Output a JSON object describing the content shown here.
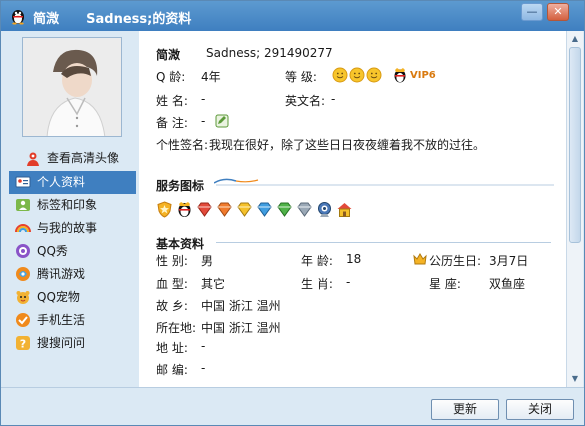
{
  "window": {
    "title": "简溦      Sadness;的资料",
    "minimize_label": "—",
    "close_label": "✕"
  },
  "left_panel": {
    "hd_avatar_link": "查看高清头像",
    "nav": [
      {
        "label": "个人资料",
        "icon": "id-card-icon",
        "active": true
      },
      {
        "label": "标签和印象",
        "icon": "tag-icon",
        "active": false
      },
      {
        "label": "与我的故事",
        "icon": "rainbow-icon",
        "active": false
      },
      {
        "label": "QQ秀",
        "icon": "qq-show-icon",
        "active": false
      },
      {
        "label": "腾讯游戏",
        "icon": "game-icon",
        "active": false
      },
      {
        "label": "QQ宠物",
        "icon": "pet-icon",
        "active": false
      },
      {
        "label": "手机生活",
        "icon": "check-mark-icon",
        "active": false
      },
      {
        "label": "搜搜问问",
        "icon": "question-icon",
        "active": false
      }
    ]
  },
  "profile": {
    "nickname": "简溦",
    "handle_and_number": "Sadness;   291490277",
    "qage_label": "Q    龄:",
    "qage_value": "4年",
    "level_label": "等    级:",
    "vip_label": "VIP6",
    "name_label": "姓    名:",
    "name_value": "-",
    "english_name_label": "英文名:",
    "english_name_value": "-",
    "remark_label": "备    注:",
    "remark_value": "-",
    "signature_label": "个性签名:",
    "signature_value": "我现在很好，除了这些日日夜夜缠着我不放的过往。"
  },
  "service_icons": {
    "title": "服务图标",
    "icons": [
      "shield-badge-icon",
      "qq-penguin-badge-icon",
      "diamond-red-icon",
      "diamond-red2-icon",
      "diamond-yellow-icon",
      "diamond-blue-icon",
      "diamond-green-icon",
      "diamond-grey-icon",
      "webcam-badge-icon",
      "house-badge-icon"
    ]
  },
  "basic_info": {
    "title": "基本资料",
    "gender_label": "性    别:",
    "gender_value": "男",
    "age_label": "年    龄:",
    "age_value": "18",
    "birthday_label": "公历生日:",
    "birthday_value": "3月7日",
    "blood_label": "血    型:",
    "blood_value": "其它",
    "zodiac_label": "生    肖:",
    "zodiac_value": "-",
    "constellation_label": "星      座:",
    "constellation_value": "双鱼座",
    "hometown_label": "故    乡:",
    "hometown_value": "中国  浙江  温州",
    "location_label": "所在地:",
    "location_value": "中国  浙江  温州",
    "address_label": "地    址:",
    "address_value": "-",
    "zip_label": "邮    编:",
    "zip_value": "-"
  },
  "buttons": {
    "refresh": "更新",
    "close": "关闭"
  },
  "colors": {
    "title_bar": "#3f7fc0",
    "selected_nav": "#3f7fc0",
    "panel_bg": "#dbe9f4"
  }
}
